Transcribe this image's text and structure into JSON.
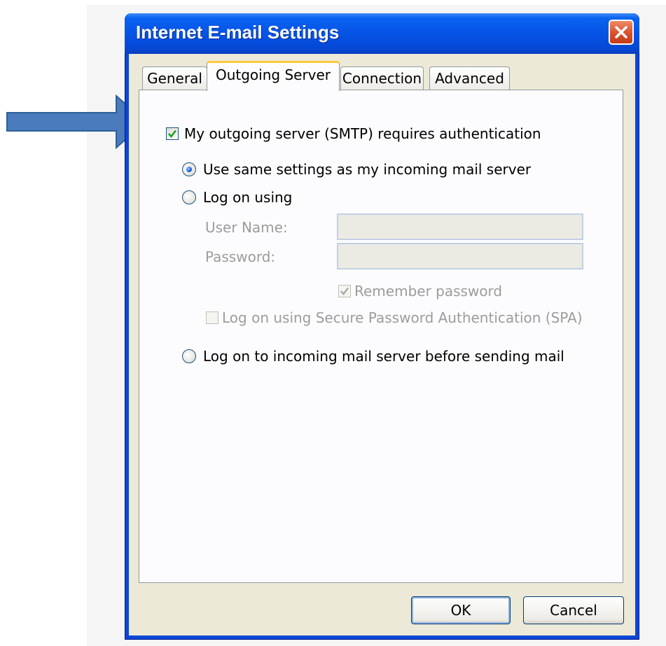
{
  "window": {
    "title": "Internet E-mail Settings",
    "title_color": "#ffffff",
    "titlebar_color": "#0653e6"
  },
  "tabs": [
    {
      "label": "General",
      "active": false
    },
    {
      "label": "Outgoing Server",
      "active": true
    },
    {
      "label": "Connection",
      "active": false
    },
    {
      "label": "Advanced",
      "active": false
    }
  ],
  "outgoing": {
    "require_auth": {
      "label": "My outgoing server (SMTP) requires authentication",
      "checked": true
    },
    "use_same": {
      "label": "Use same settings as my incoming mail server",
      "selected": true
    },
    "log_on_using": {
      "label": "Log on using",
      "selected": false
    },
    "user_name": {
      "label": "User Name:",
      "value": ""
    },
    "password": {
      "label": "Password:",
      "value": ""
    },
    "remember_password": {
      "label": "Remember password",
      "checked": true,
      "disabled": true
    },
    "spa": {
      "label": "Log on using Secure Password Authentication (SPA)",
      "checked": false,
      "disabled": true
    },
    "log_on_incoming_first": {
      "label": "Log on to incoming mail server before sending mail",
      "selected": false
    }
  },
  "buttons": {
    "ok": "OK",
    "cancel": "Cancel"
  },
  "annotation": {
    "icon": "arrow-right-icon",
    "color": "#4a7bbd"
  }
}
